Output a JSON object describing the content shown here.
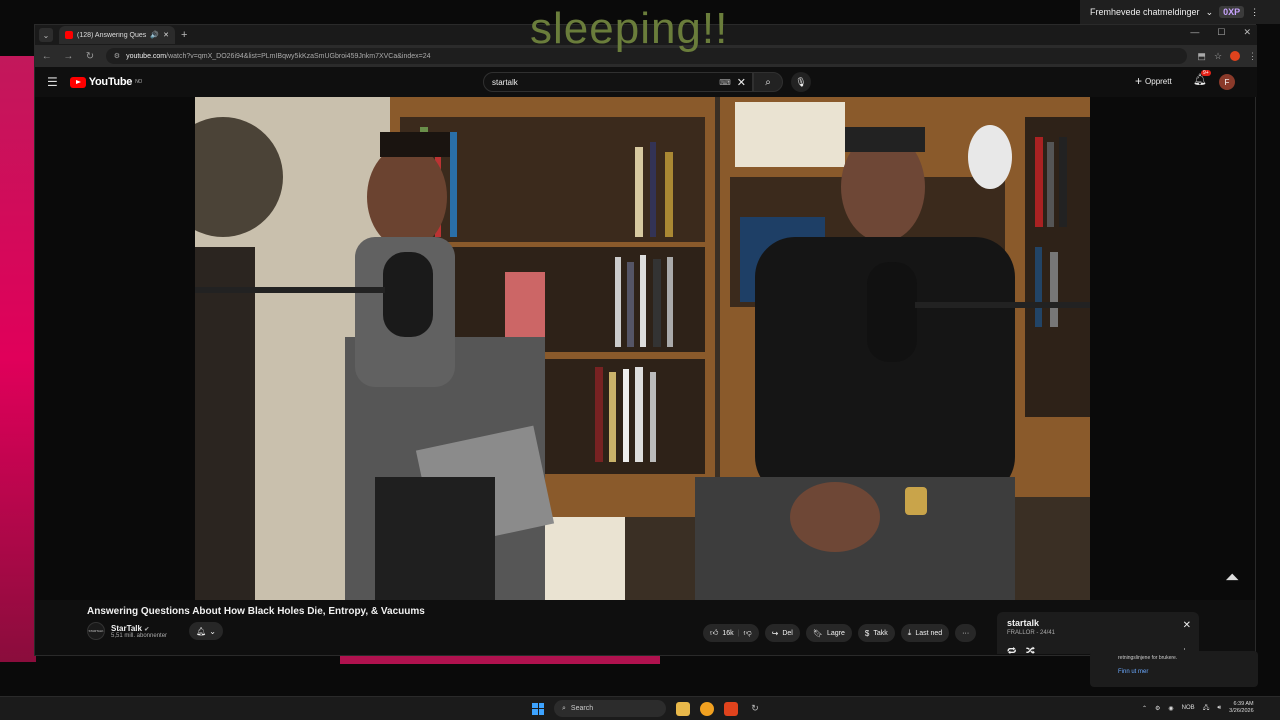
{
  "stream": {
    "overlay_text": "sleeping!!",
    "chat_label": "Fremhevede chatmeldinger",
    "chat_chevron": "⌄",
    "xp_label": "0XP",
    "chat_more": "⋮"
  },
  "browser": {
    "tab_title": "(128) Answering Questions...",
    "tab_audio": "🔊",
    "tab_close": "✕",
    "new_tab": "+",
    "url_domain": "youtube.com",
    "url_path": "/watch?v=qmX_DO26i94&list=PLmIBqwy5kKzaSmUGbroi459Jnkm7XVCa&index=24",
    "window_controls": [
      "—",
      "☐",
      "✕"
    ]
  },
  "youtube": {
    "logo_text": "YouTube",
    "logo_region": "NO",
    "search_value": "startalk",
    "create_label": "Opprett",
    "notification_badge": "9+",
    "avatar_letter": "F"
  },
  "video": {
    "title": "Answering Questions About How Black Holes Die, Entropy, & Vacuums",
    "channel_name": "StarTalk",
    "channel_verified": "✔",
    "channel_avatar_text": "STARTALK",
    "subscribers": "5,51 mill. abonnenter",
    "like_count": "16k",
    "share_label": "Del",
    "save_label": "Lagre",
    "thanks_label": "Takk",
    "download_label": "Last ned",
    "more_label": "···"
  },
  "playlist": {
    "title": "startalk",
    "subtitle": "FRALLOR - 24/41"
  },
  "toast": {
    "text": "retningslinjene for brukere.",
    "link": "Finn ut mer"
  },
  "taskbar": {
    "search_placeholder": "Search",
    "language": "NOB",
    "time": "6:39 AM",
    "date": "3/26/2026"
  },
  "colors": {
    "accent_red": "#ff0000",
    "page_bg": "#0f0f0f",
    "stream_pink": "#e0005a"
  }
}
